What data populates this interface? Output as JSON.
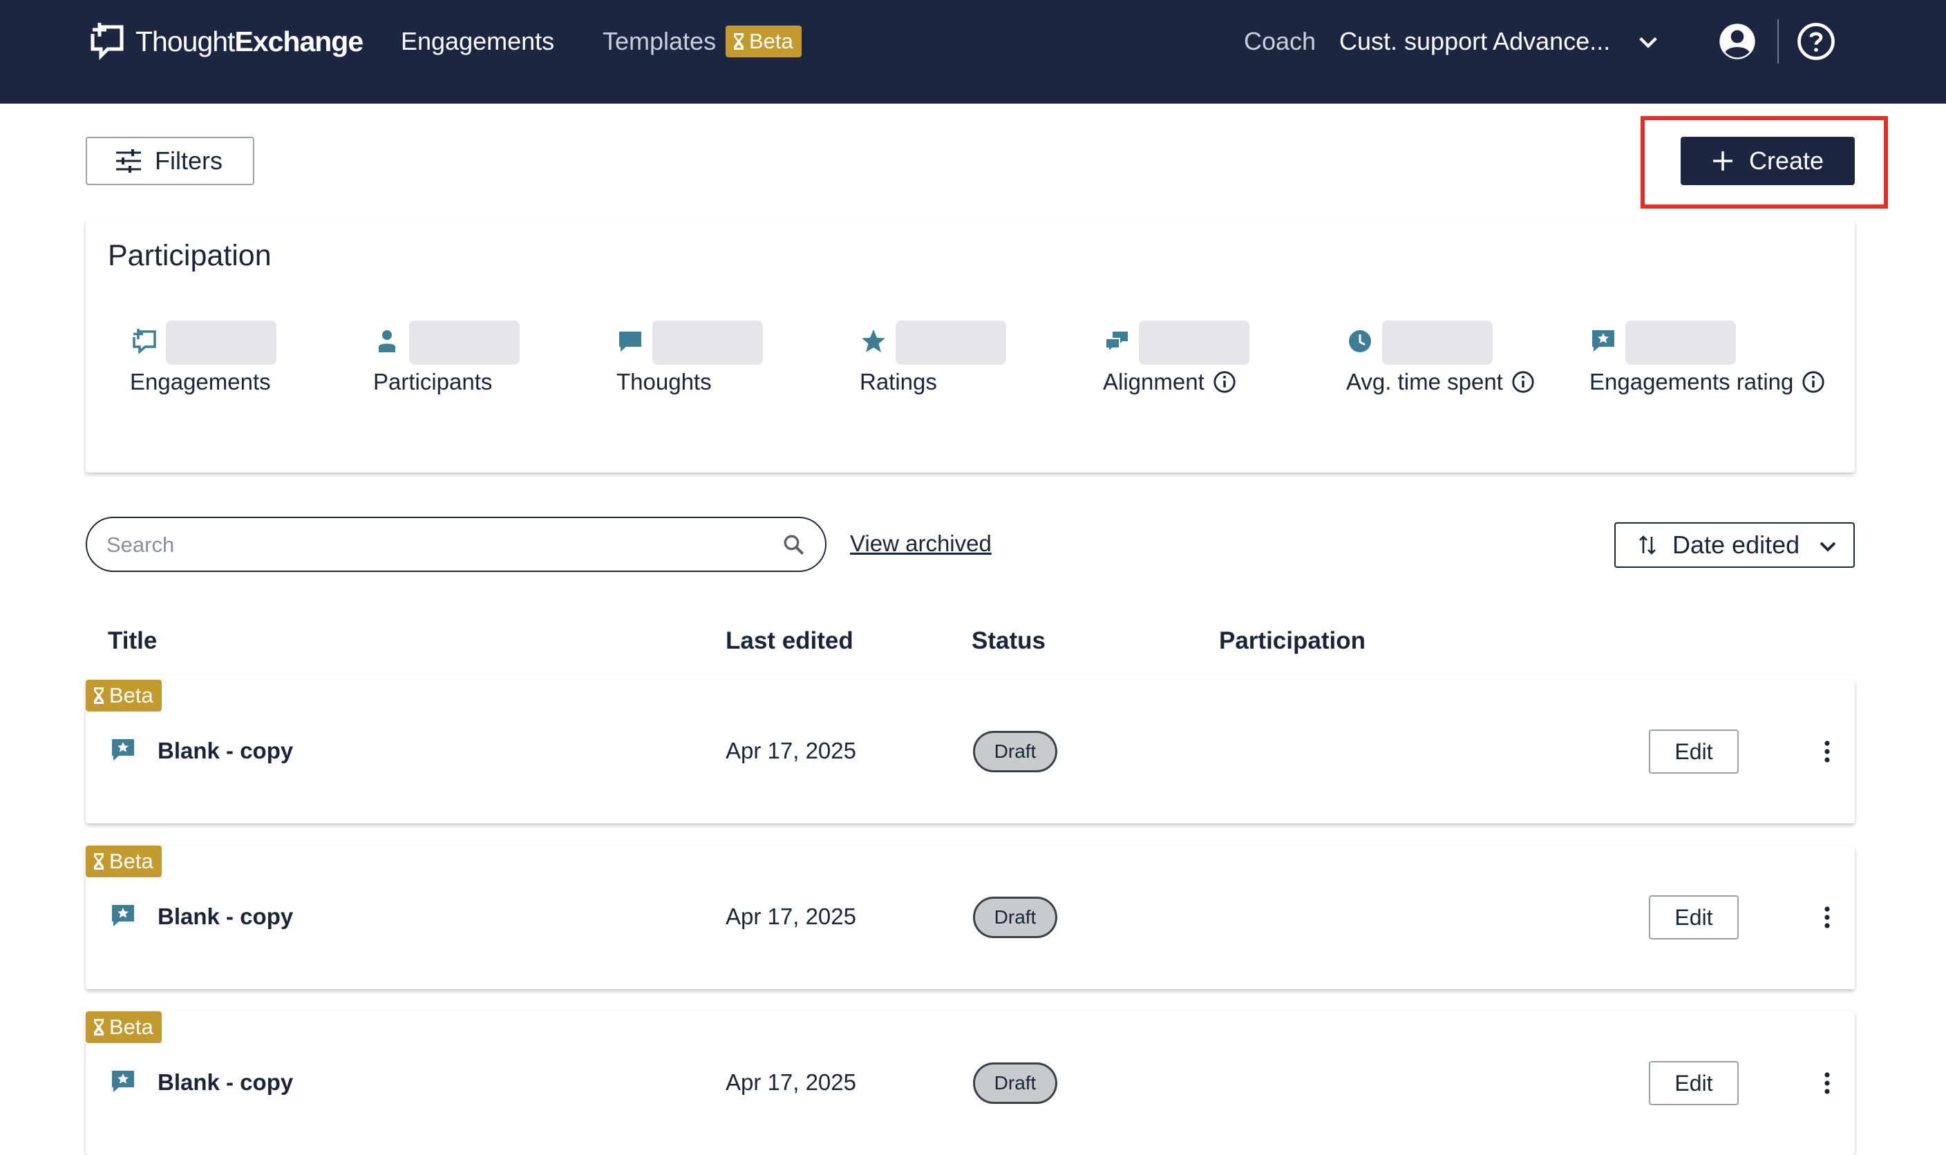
{
  "header": {
    "logo_text_light": "Thought",
    "logo_text_bold": "Exchange",
    "nav": [
      {
        "label": "Engagements"
      },
      {
        "label": "Templates"
      }
    ],
    "templates_badge": "Beta",
    "coach_label": "Coach",
    "org_selector": "Cust. support Advance...",
    "icons": {
      "account": "account-circle-icon",
      "help": "help-circle-icon",
      "org_dropdown": "chevron-down-icon"
    }
  },
  "toolbar": {
    "filters_label": "Filters",
    "create_label": "Create"
  },
  "participation": {
    "title": "Participation",
    "stats": [
      {
        "label": "Engagements",
        "icon": "engagements-icon",
        "info": false
      },
      {
        "label": "Participants",
        "icon": "person-icon",
        "info": false
      },
      {
        "label": "Thoughts",
        "icon": "speech-bubble-icon",
        "info": false
      },
      {
        "label": "Ratings",
        "icon": "star-icon",
        "info": false
      },
      {
        "label": "Alignment",
        "icon": "alignment-icon",
        "info": true
      },
      {
        "label": "Avg. time spent",
        "icon": "clock-icon",
        "info": true
      },
      {
        "label": "Engagements rating",
        "icon": "rating-chat-icon",
        "info": true
      }
    ]
  },
  "search": {
    "placeholder": "Search",
    "value": "",
    "view_archived": "View archived",
    "sort_label": "Date edited"
  },
  "table": {
    "columns": [
      "Title",
      "Last edited",
      "Status",
      "Participation"
    ],
    "rows": [
      {
        "badge": "Beta",
        "title": "Blank - copy",
        "last_edited": "Apr 17, 2025",
        "status": "Draft",
        "action": "Edit"
      },
      {
        "badge": "Beta",
        "title": "Blank - copy",
        "last_edited": "Apr 17, 2025",
        "status": "Draft",
        "action": "Edit"
      },
      {
        "badge": "Beta",
        "title": "Blank - copy",
        "last_edited": "Apr 17, 2025",
        "status": "Draft",
        "action": "Edit"
      }
    ]
  },
  "colors": {
    "header_bg": "#1c2641",
    "accent_icon": "#3d7d96",
    "beta_badge": "#c29a2d",
    "highlight": "#e0312b",
    "draft_pill": "#c8cacd"
  }
}
